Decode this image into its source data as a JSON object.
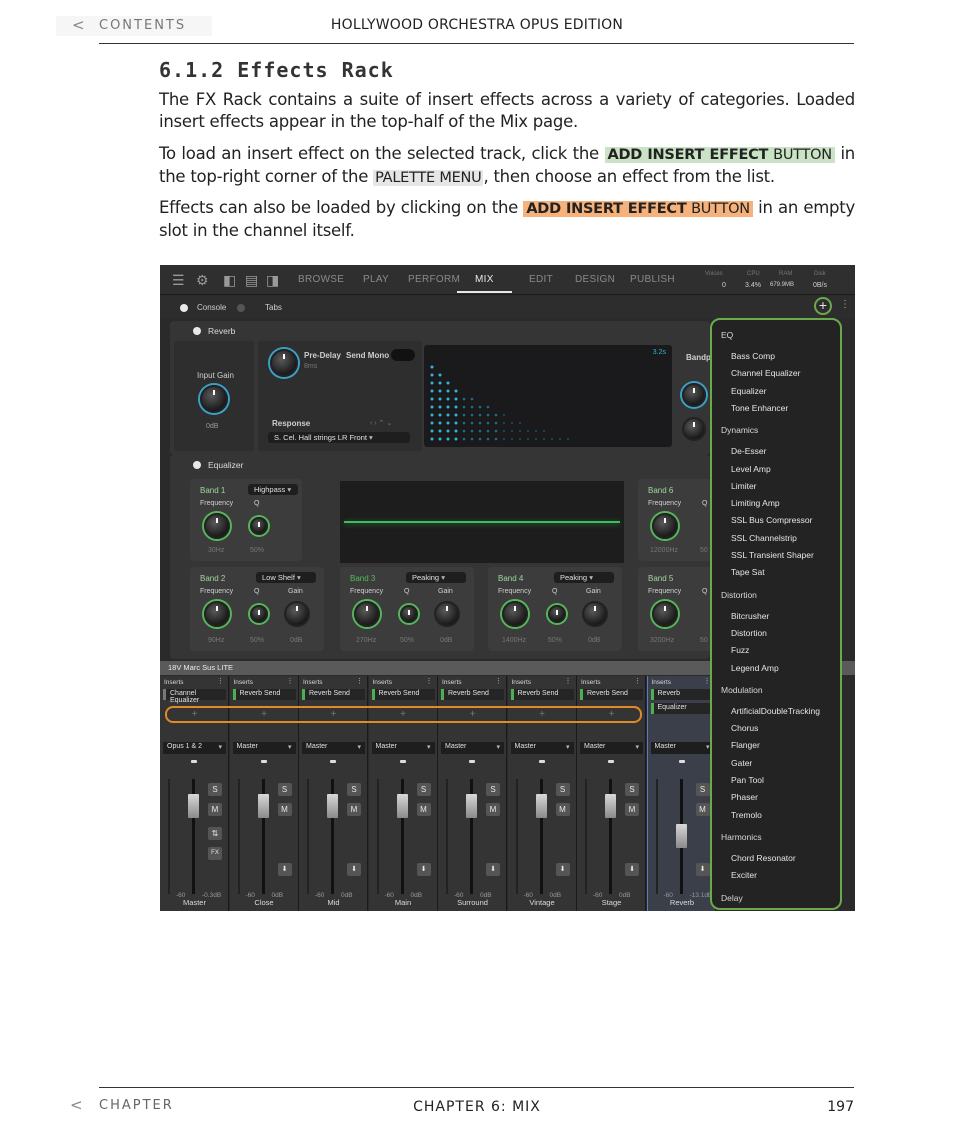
{
  "header": {
    "back_chevron": "<",
    "back_label": "CONTENTS",
    "title": "HOLLYWOOD ORCHESTRA OPUS EDITION"
  },
  "section": {
    "heading": "6.1.2 Effects Rack",
    "p1": "The FX Rack contains a suite of insert effects across a variety of categories. Loaded insert effects appear in the top-half of the Mix page.",
    "p2_a": "To load an insert effect on the selected track, click the ",
    "p2_btn_bold": "ADD INSERT EFFECT",
    "p2_btn_rest": " BUTTON",
    "p2_b": " in the top-right corner of the ",
    "p2_palette": "PALETTE MENU",
    "p2_c": ", then choose an effect from the list.",
    "p3_a": "Effects can also be loaded by clicking on the ",
    "p3_btn_bold": "ADD INSERT EFFECT",
    "p3_btn_rest": " BUTTON",
    "p3_b": " in an empty slot in the channel itself."
  },
  "screenshot": {
    "nav_tabs": [
      "BROWSE",
      "PLAY",
      "PERFORM",
      "MIX",
      "EDIT",
      "DESIGN",
      "PUBLISH"
    ],
    "stats": {
      "voices_label": "Voices",
      "voices": "0",
      "cpu_label": "CPU",
      "cpu": "3.4%",
      "ram_label": "RAM",
      "ram": "679.9MB",
      "disk_label": "Disk",
      "disk": "0B/s"
    },
    "view_console": "Console",
    "view_tabs": "Tabs",
    "reverb": {
      "title": "Reverb",
      "input_gain": "Input Gain",
      "input_gain_val": "0dB",
      "predelay": "Pre-Delay",
      "predelay_val": "8ms",
      "send_mono": "Send Mono",
      "response": "Response",
      "response_val": "S. Cel. Hall strings LR Front",
      "display_val": "3.2s",
      "bandpass": "Bandpa"
    },
    "eq": {
      "title": "Equalizer",
      "frequency": "Frequency",
      "q": "Q",
      "gain": "Gain",
      "band1": "Band 1",
      "band1_type": "Highpass",
      "band1_freq": "30Hz",
      "band1_q": "50%",
      "band6": "Band 6",
      "band6_freq": "12000Hz",
      "band6_q": "50",
      "band2": "Band 2",
      "band2_type": "Low Shelf",
      "band2_freq": "90Hz",
      "band2_q": "50%",
      "band2_gain": "0dB",
      "band3": "Band 3",
      "band3_type": "Peaking",
      "band3_freq": "270Hz",
      "band3_q": "50%",
      "band3_gain": "0dB",
      "band4": "Band 4",
      "band4_type": "Peaking",
      "band4_freq": "1400Hz",
      "band4_q": "50%",
      "band4_gain": "0dB",
      "band5": "Band 5",
      "band5_freq": "3200Hz",
      "band5_q": "50"
    },
    "mixer": {
      "title": "18V Marc Sus LITE",
      "inserts_label": "Inserts",
      "strips": [
        {
          "name": "Master",
          "slot": "Channel Equalizer",
          "route": "Opus 1 & 2",
          "val_r": "-0.3dB"
        },
        {
          "name": "Close",
          "slot": "Reverb Send",
          "route": "Master",
          "val_r": "0dB"
        },
        {
          "name": "Mid",
          "slot": "Reverb Send",
          "route": "Master",
          "val_r": "0dB"
        },
        {
          "name": "Main",
          "slot": "Reverb Send",
          "route": "Master",
          "val_r": "0dB"
        },
        {
          "name": "Surround",
          "slot": "Reverb Send",
          "route": "Master",
          "val_r": "0dB"
        },
        {
          "name": "Vintage",
          "slot": "Reverb Send",
          "route": "Master",
          "val_r": "0dB"
        },
        {
          "name": "Stage",
          "slot": "Reverb Send",
          "route": "Master",
          "val_r": "0dB"
        },
        {
          "name": "Reverb",
          "slot": "Reverb",
          "slot2": "Equalizer",
          "route": "Master",
          "val_r": "-13.1dB"
        }
      ],
      "solo": "S",
      "mute": "M",
      "fx": "FX",
      "plus": "+",
      "val_l": "-60"
    },
    "palette": {
      "categories": [
        {
          "name": "EQ",
          "items": [
            "Bass Comp",
            "Channel Equalizer",
            "Equalizer",
            "Tone Enhancer"
          ]
        },
        {
          "name": "Dynamics",
          "items": [
            "De-Esser",
            "Level Amp",
            "Limiter",
            "Limiting Amp",
            "SSL Bus Compressor",
            "SSL Channelstrip",
            "SSL Transient Shaper",
            "Tape Sat"
          ]
        },
        {
          "name": "Distortion",
          "items": [
            "Bitcrusher",
            "Distortion",
            "Fuzz",
            "Legend Amp"
          ]
        },
        {
          "name": "Modulation",
          "items": [
            "ArtificialDoubleTracking",
            "Chorus",
            "Flanger",
            "Gater",
            "Pan Tool",
            "Phaser",
            "Tremolo"
          ]
        },
        {
          "name": "Harmonics",
          "items": [
            "Chord Resonator",
            "Exciter"
          ]
        },
        {
          "name": "Delay",
          "items": []
        }
      ]
    },
    "colors": {
      "accent_green": "#6aaa4a",
      "accent_orange": "#e08a2a",
      "accent_teal": "#3aa0c8"
    }
  },
  "footer": {
    "back_chevron": "<",
    "label": "CHAPTER",
    "chapter": "CHAPTER 6:  MIX",
    "page": "197"
  }
}
